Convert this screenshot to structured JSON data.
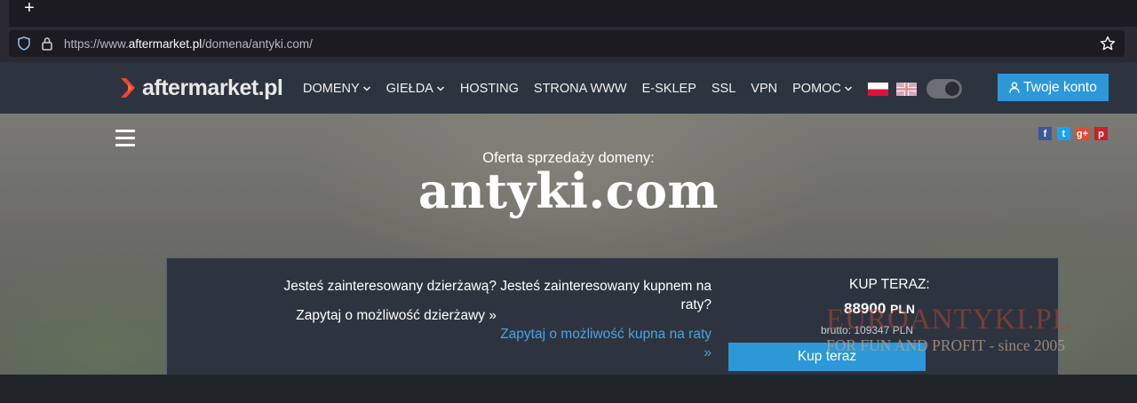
{
  "browser": {
    "new_tab_symbol": "+",
    "url_prefix": "https://www.",
    "url_host": "aftermarket.pl",
    "url_path": "/domena/antyki.com/"
  },
  "header": {
    "logo_text": "aftermarket.pl",
    "nav": [
      {
        "label": "DOMENY",
        "has_dropdown": true
      },
      {
        "label": "GIEŁDA",
        "has_dropdown": true
      },
      {
        "label": "HOSTING",
        "has_dropdown": false
      },
      {
        "label": "STRONA WWW",
        "has_dropdown": false
      },
      {
        "label": "E-SKLEP",
        "has_dropdown": false
      },
      {
        "label": "SSL",
        "has_dropdown": false
      },
      {
        "label": "VPN",
        "has_dropdown": false
      },
      {
        "label": "POMOC",
        "has_dropdown": true
      }
    ],
    "account_button": "Twoje konto"
  },
  "hero": {
    "offer_label": "Oferta sprzedaży domeny:",
    "domain": "antyki.com",
    "social": [
      "f",
      "t",
      "g+",
      "p"
    ]
  },
  "offer": {
    "lease_question": "Jesteś zainteresowany dzierżawą?",
    "lease_link": "Zapytaj o możliwość dzierżawy »",
    "installment_question": "Jesteś zainteresowany kupnem na raty?",
    "installment_link": "Zapytaj o możliwość kupna na raty »",
    "buy_label": "KUP TERAZ:",
    "price": "88900",
    "currency": "PLN",
    "brutto": "brutto: 109347 PLN",
    "buy_button": "Kup teraz"
  },
  "watermark": {
    "line1": "EUROANTYKI.PL",
    "line2": "FOR FUN AND PROFIT - since 2005"
  },
  "colors": {
    "accent": "#2c98d8",
    "header_bg": "#2c3440",
    "link_blue": "#4aa3df"
  }
}
